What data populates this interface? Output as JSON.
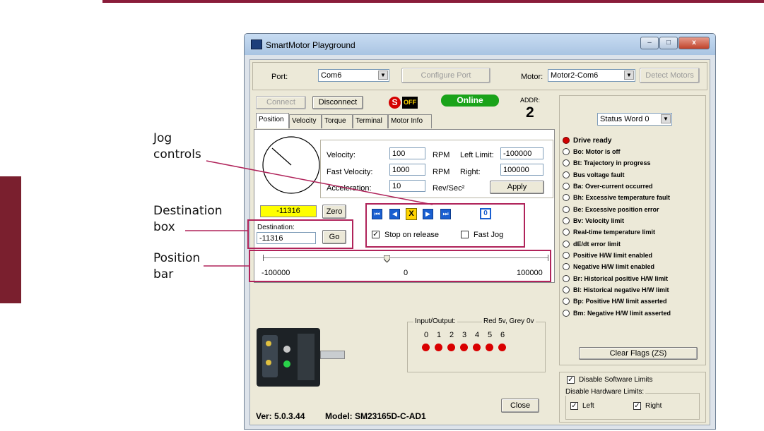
{
  "callouts": {
    "jog_line1": "Jog",
    "jog_line2": "controls",
    "destination_line1": "Destination",
    "destination_line2": "box",
    "position_line1": "Position",
    "position_line2": "bar"
  },
  "window": {
    "title": "SmartMotor Playground",
    "min_label": "–",
    "max_label": "□",
    "close_label": "x"
  },
  "toolbar": {
    "port_label": "Port:",
    "port_value": "Com6",
    "configure_port": "Configure Port",
    "motor_label": "Motor:",
    "motor_value": "Motor2-Com6",
    "detect_motors": "Detect Motors",
    "connect": "Connect",
    "disconnect": "Disconnect",
    "s_badge": "S",
    "off_badge": "OFF",
    "online": "Online",
    "addr_label": "ADDR:",
    "addr_value": "2"
  },
  "tabs": [
    "Position",
    "Velocity",
    "Torque",
    "Terminal",
    "Motor Info"
  ],
  "position": {
    "velocity_label": "Velocity:",
    "velocity_value": "100",
    "velocity_unit": "RPM",
    "fast_velocity_label": "Fast Velocity:",
    "fast_velocity_value": "1000",
    "fast_velocity_unit": "RPM",
    "acceleration_label": "Acceleration:",
    "acceleration_value": "10",
    "acceleration_unit": "Rev/Sec²",
    "left_limit_label": "Left Limit:",
    "left_limit_value": "-100000",
    "right_label": "Right:",
    "right_value": "100000",
    "apply": "Apply",
    "current_position": "-11316",
    "zero": "Zero",
    "destination_label": "Destination:",
    "destination_value": "-11316",
    "go": "Go",
    "jog_zero": "0",
    "stop_on_release": "Stop on release",
    "fast_jog": "Fast Jog",
    "bar_min": "-100000",
    "bar_mid": "0",
    "bar_max": "100000"
  },
  "io": {
    "label": "Input/Output:",
    "legend": "Red 5v, Grey 0v",
    "channels": [
      "0",
      "1",
      "2",
      "3",
      "4",
      "5",
      "6"
    ]
  },
  "footer": {
    "version": "Ver: 5.0.3.44",
    "model": "Model:  SM23165D-C-AD1",
    "close": "Close"
  },
  "status": {
    "selector": "Status Word 0",
    "items": [
      "Drive ready",
      "Bo:  Motor is off",
      "Bt:  Trajectory in progress",
      "Bus voltage fault",
      "Ba:  Over-current occurred",
      "Bh:  Excessive temperature fault",
      "Be:  Excessive position error",
      "Bv:  Velocity limit",
      "Real-time temperature limit",
      "dE/dt error limit",
      "Positive H/W limit enabled",
      "Negative H/W limit enabled",
      "Br:  Historical positive H/W limit",
      "Bl:  Historical negative H/W limit",
      "Bp:  Positive H/W limit asserted",
      "Bm:  Negative H/W limit asserted"
    ],
    "clear_flags": "Clear Flags (ZS)"
  },
  "limits": {
    "disable_software": "Disable Software Limits",
    "disable_hardware": "Disable Hardware Limits:",
    "left": "Left",
    "right": "Right"
  },
  "colors": {
    "brand": "#8a1c3a",
    "online": "#1aa31a",
    "jog_blue": "#1a5fd0",
    "led_red": "#d90000"
  }
}
